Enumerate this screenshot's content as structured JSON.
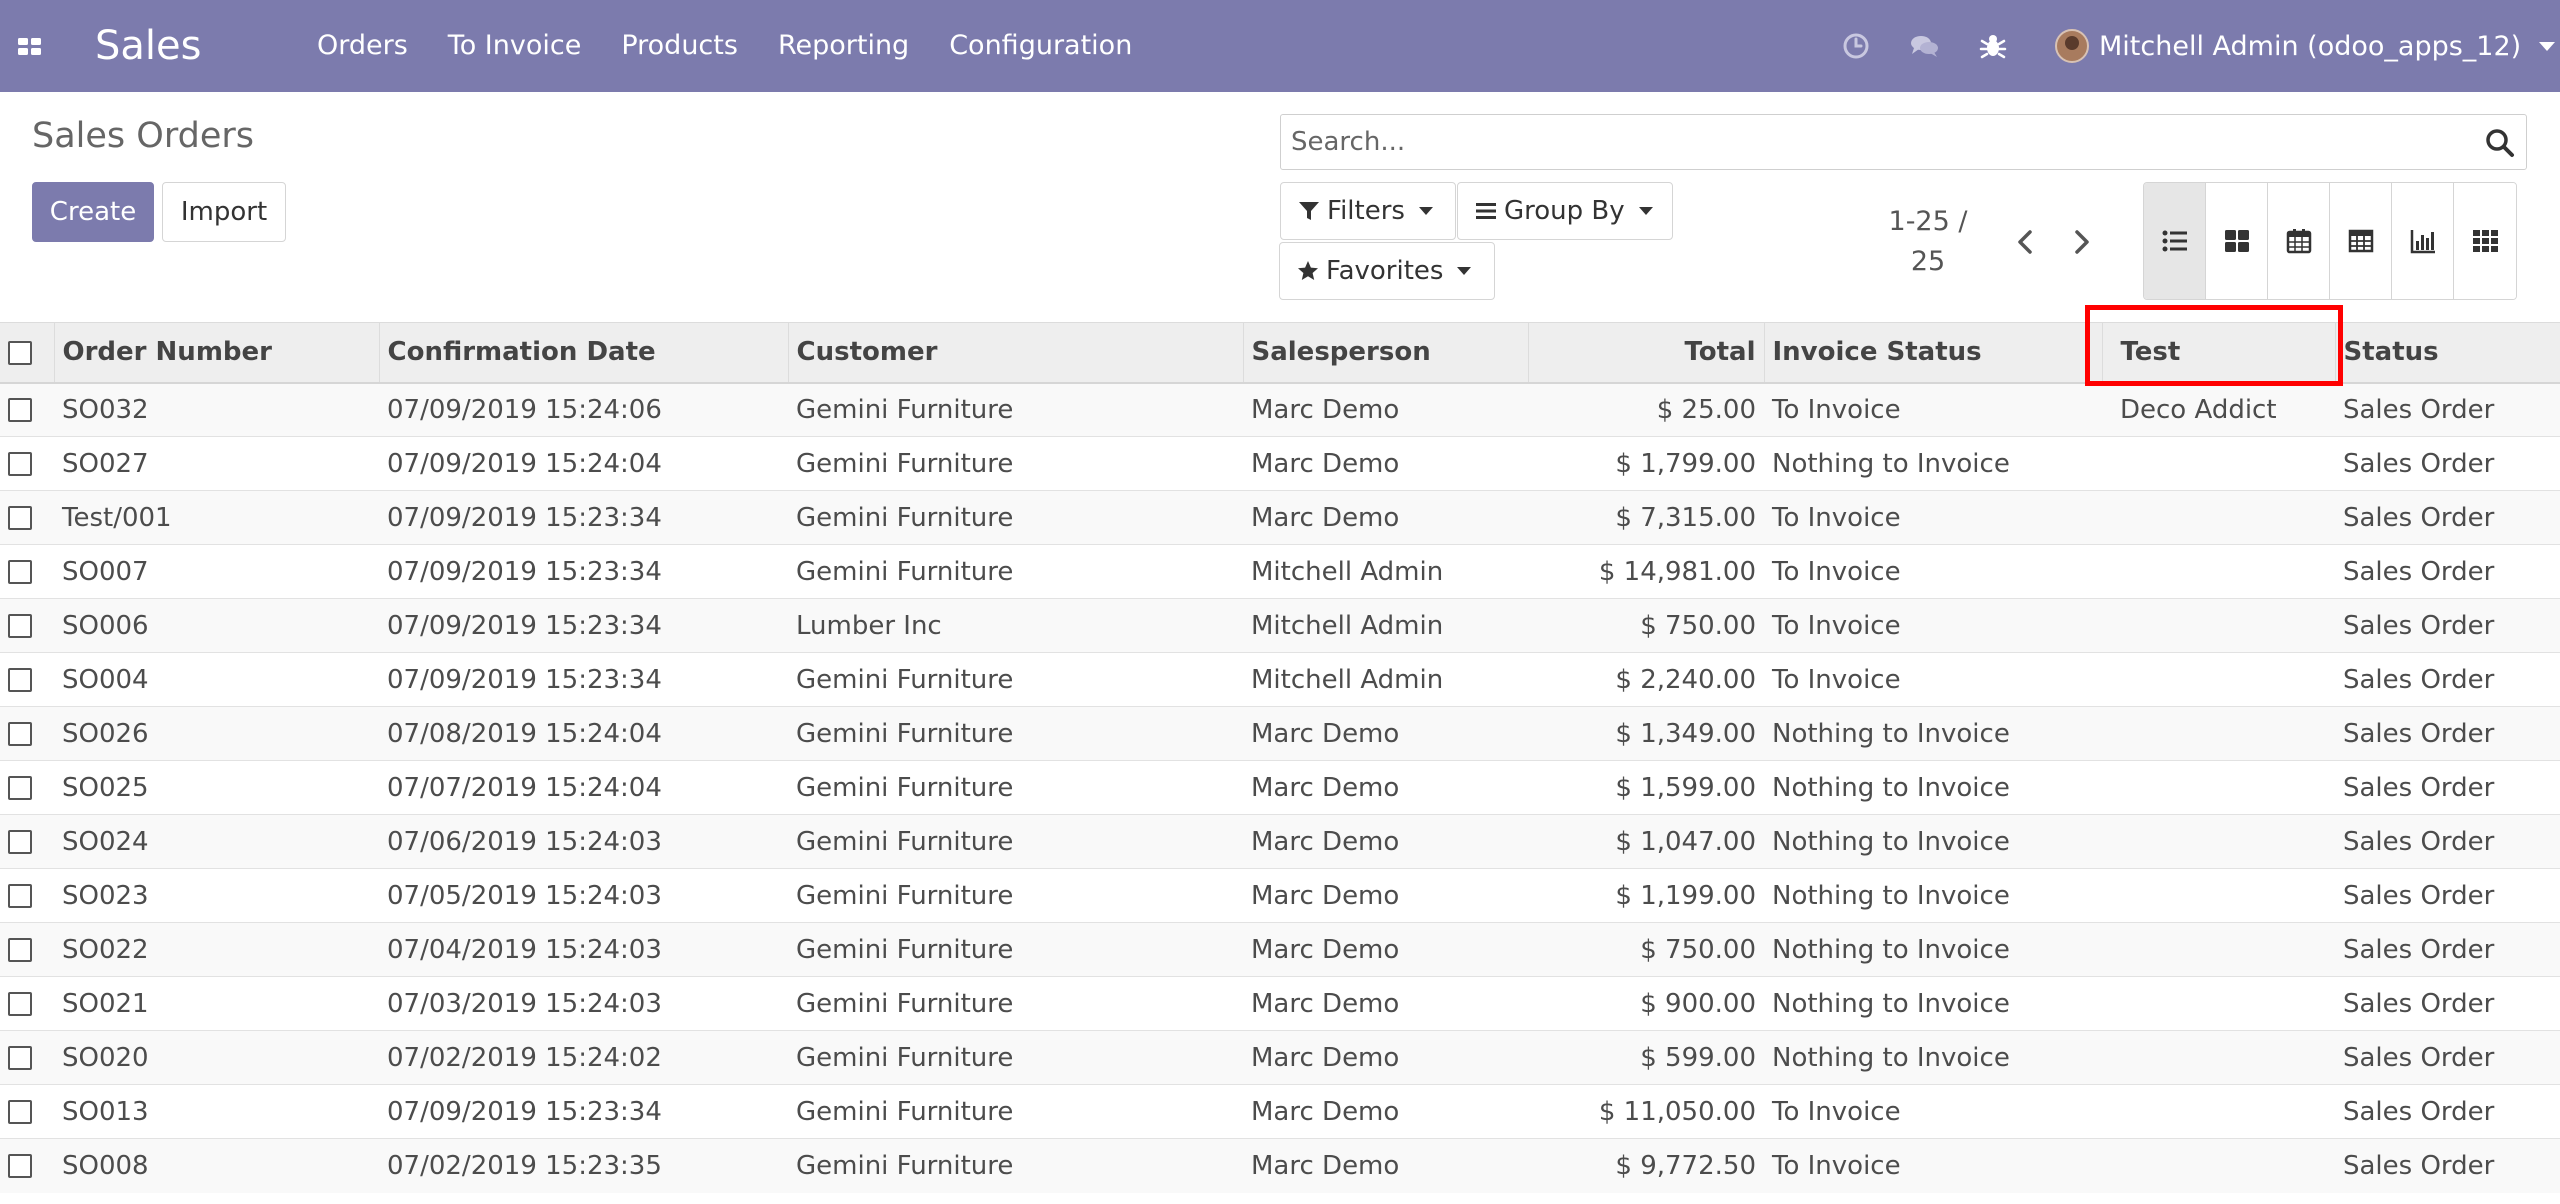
{
  "navbar": {
    "brand": "Sales",
    "menu": [
      "Orders",
      "To Invoice",
      "Products",
      "Reporting",
      "Configuration"
    ],
    "user_name": "Mitchell Admin (odoo_apps_12)",
    "icons": [
      "apps-icon",
      "clock-icon",
      "chat-icon",
      "bug-icon",
      "avatar"
    ]
  },
  "control_panel": {
    "title": "Sales Orders",
    "create_label": "Create",
    "import_label": "Import",
    "search_placeholder": "Search...",
    "filters_label": "Filters",
    "groupby_label": "Group By",
    "favorites_label": "Favorites",
    "pager": "1-25 / 25",
    "views": [
      "list",
      "kanban",
      "calendar",
      "pivot",
      "graph",
      "activity"
    ],
    "active_view": "list"
  },
  "table": {
    "columns": [
      "Order Number",
      "Confirmation Date",
      "Customer",
      "Salesperson",
      "Total",
      "Invoice Status",
      "Test",
      "Status"
    ],
    "highlighted_column": "Test",
    "rows": [
      {
        "order": "SO032",
        "date": "07/09/2019 15:24:06",
        "customer": "Gemini Furniture",
        "salesperson": "Marc Demo",
        "total": "$ 25.00",
        "invoice_status": "To Invoice",
        "test": "Deco Addict",
        "status": "Sales Order"
      },
      {
        "order": "SO027",
        "date": "07/09/2019 15:24:04",
        "customer": "Gemini Furniture",
        "salesperson": "Marc Demo",
        "total": "$ 1,799.00",
        "invoice_status": "Nothing to Invoice",
        "test": "",
        "status": "Sales Order"
      },
      {
        "order": "Test/001",
        "date": "07/09/2019 15:23:34",
        "customer": "Gemini Furniture",
        "salesperson": "Marc Demo",
        "total": "$ 7,315.00",
        "invoice_status": "To Invoice",
        "test": "",
        "status": "Sales Order"
      },
      {
        "order": "SO007",
        "date": "07/09/2019 15:23:34",
        "customer": "Gemini Furniture",
        "salesperson": "Mitchell Admin",
        "total": "$ 14,981.00",
        "invoice_status": "To Invoice",
        "test": "",
        "status": "Sales Order"
      },
      {
        "order": "SO006",
        "date": "07/09/2019 15:23:34",
        "customer": "Lumber Inc",
        "salesperson": "Mitchell Admin",
        "total": "$ 750.00",
        "invoice_status": "To Invoice",
        "test": "",
        "status": "Sales Order"
      },
      {
        "order": "SO004",
        "date": "07/09/2019 15:23:34",
        "customer": "Gemini Furniture",
        "salesperson": "Mitchell Admin",
        "total": "$ 2,240.00",
        "invoice_status": "To Invoice",
        "test": "",
        "status": "Sales Order"
      },
      {
        "order": "SO026",
        "date": "07/08/2019 15:24:04",
        "customer": "Gemini Furniture",
        "salesperson": "Marc Demo",
        "total": "$ 1,349.00",
        "invoice_status": "Nothing to Invoice",
        "test": "",
        "status": "Sales Order"
      },
      {
        "order": "SO025",
        "date": "07/07/2019 15:24:04",
        "customer": "Gemini Furniture",
        "salesperson": "Marc Demo",
        "total": "$ 1,599.00",
        "invoice_status": "Nothing to Invoice",
        "test": "",
        "status": "Sales Order"
      },
      {
        "order": "SO024",
        "date": "07/06/2019 15:24:03",
        "customer": "Gemini Furniture",
        "salesperson": "Marc Demo",
        "total": "$ 1,047.00",
        "invoice_status": "Nothing to Invoice",
        "test": "",
        "status": "Sales Order"
      },
      {
        "order": "SO023",
        "date": "07/05/2019 15:24:03",
        "customer": "Gemini Furniture",
        "salesperson": "Marc Demo",
        "total": "$ 1,199.00",
        "invoice_status": "Nothing to Invoice",
        "test": "",
        "status": "Sales Order"
      },
      {
        "order": "SO022",
        "date": "07/04/2019 15:24:03",
        "customer": "Gemini Furniture",
        "salesperson": "Marc Demo",
        "total": "$ 750.00",
        "invoice_status": "Nothing to Invoice",
        "test": "",
        "status": "Sales Order"
      },
      {
        "order": "SO021",
        "date": "07/03/2019 15:24:03",
        "customer": "Gemini Furniture",
        "salesperson": "Marc Demo",
        "total": "$ 900.00",
        "invoice_status": "Nothing to Invoice",
        "test": "",
        "status": "Sales Order"
      },
      {
        "order": "SO020",
        "date": "07/02/2019 15:24:02",
        "customer": "Gemini Furniture",
        "salesperson": "Marc Demo",
        "total": "$ 599.00",
        "invoice_status": "Nothing to Invoice",
        "test": "",
        "status": "Sales Order"
      },
      {
        "order": "SO013",
        "date": "07/09/2019 15:23:34",
        "customer": "Gemini Furniture",
        "salesperson": "Marc Demo",
        "total": "$ 11,050.00",
        "invoice_status": "To Invoice",
        "test": "",
        "status": "Sales Order"
      },
      {
        "order": "SO008",
        "date": "07/02/2019 15:23:35",
        "customer": "Gemini Furniture",
        "salesperson": "Marc Demo",
        "total": "$ 9,772.50",
        "invoice_status": "To Invoice",
        "test": "",
        "status": "Sales Order"
      }
    ]
  },
  "colors": {
    "navbar": "#7c7bad",
    "primary_button": "#7c7bad",
    "highlight": "#ff0000"
  }
}
